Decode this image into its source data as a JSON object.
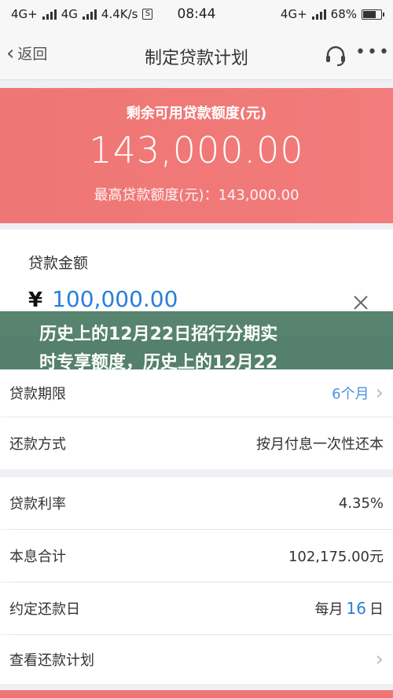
{
  "status": {
    "left_net1": "4G+",
    "left_net2": "4G",
    "speed": "4.4K/s",
    "time": "08:44",
    "right_net": "4G+",
    "battery": "68%"
  },
  "nav": {
    "back_label": "返回",
    "title": "制定贷款计划"
  },
  "hero": {
    "title": "剩余可用贷款额度(元)",
    "amount": "143,000.00",
    "max_line": "最高贷款额度(元)：143,000.00"
  },
  "loan": {
    "label": "贷款金额",
    "currency": "¥",
    "value": "100,000.00"
  },
  "banner": {
    "line1": "历史上的12月22日招行分期实",
    "line2": "时专享额度，历史上的12月22"
  },
  "rows": {
    "term_label": "贷款期限",
    "term_value": "6个月",
    "repay_label": "还款方式",
    "repay_value": "按月付息一次性还本",
    "rate_label": "贷款利率",
    "rate_value": "4.35%",
    "total_label": "本息合计",
    "total_value": "102,175.00元",
    "due_label": "约定还款日",
    "due_prefix": "每月",
    "due_day": "16",
    "due_suffix": "日",
    "plan_label": "查看还款计划"
  },
  "colors": {
    "accent": "#ee7674",
    "link_blue": "#2a7fd6",
    "banner_bg": "#286046"
  }
}
